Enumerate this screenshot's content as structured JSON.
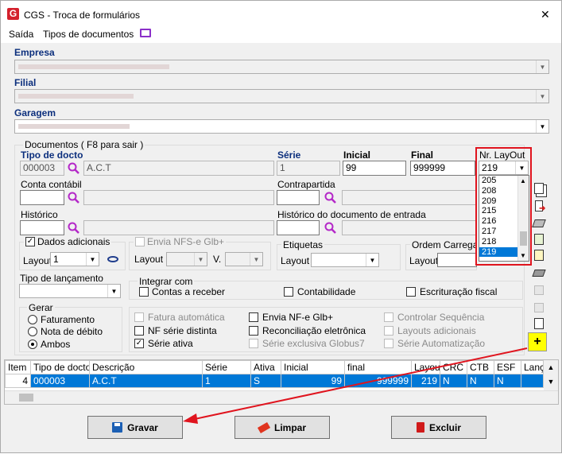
{
  "window": {
    "title": "CGS - Troca de formulários",
    "close_glyph": "✕"
  },
  "menu": {
    "exit": "Saída",
    "doc_types": "Tipos de documentos"
  },
  "empresa": {
    "label": "Empresa"
  },
  "filial": {
    "label": "Filial"
  },
  "garagem": {
    "label": "Garagem"
  },
  "docs_group": "Documentos ( F8 para sair )",
  "tipo_docto": {
    "label": "Tipo de docto",
    "code": "000003",
    "desc": "A.C.T"
  },
  "serie": {
    "label": "Série",
    "value": "1"
  },
  "inicial": {
    "label": "Inicial",
    "value": "99"
  },
  "final": {
    "label": "Final",
    "value": "999999"
  },
  "layout_nr": {
    "label": "Nr. LayOut",
    "value": "219",
    "options": [
      "205",
      "208",
      "209",
      "215",
      "216",
      "217",
      "218",
      "219"
    ],
    "selected": "219"
  },
  "conta": {
    "label": "Conta contábil"
  },
  "contrapartida": {
    "label": "Contrapartida"
  },
  "historico": {
    "label": "Histórico"
  },
  "hist_entrada": {
    "label": "Histórico do documento de entrada"
  },
  "dados": {
    "label": "Dados adicionais",
    "checked": true,
    "layout_label": "Layout",
    "layout_value": "1"
  },
  "nfse": {
    "label": "Envia NFS-e Glb+",
    "layout_label": "Layout",
    "v_label": "V."
  },
  "etiquetas": {
    "label": "Etiquetas",
    "layout_label": "Layout"
  },
  "ordem": {
    "label": "Ordem Carregame",
    "layout_label": "Layout"
  },
  "tipo_lanc": {
    "label": "Tipo de lançamento"
  },
  "integrar": {
    "label": "Integrar com",
    "contas": "Contas a receber",
    "contab": "Contabilidade",
    "escrit": "Escrituração fiscal"
  },
  "gerar": {
    "label": "Gerar",
    "fat": "Faturamento",
    "nd": "Nota de débito",
    "ambos": "Ambos",
    "selected": "Ambos"
  },
  "opts": {
    "fat_auto": "Fatura automática",
    "nf_serie": "NF série distinta",
    "serie_ativa": "Série ativa",
    "envia_nfe": "Envia NF-e Glb+",
    "recon": "Reconciliação eletrônica",
    "serie_excl": "Série exclusiva Globus7",
    "ctrl_seq": "Controlar Sequência",
    "layouts_ad": "Layouts adicionais",
    "serie_auto": "Série Automatização",
    "plus": "+"
  },
  "grid": {
    "headers": [
      "Item",
      "Tipo de docto",
      "Descrição",
      "Série",
      "Ativa",
      "Inicial",
      "final",
      "Layout",
      "CRC",
      "CTB",
      "ESF",
      "Lanç"
    ],
    "row": [
      "4",
      "000003",
      "A.C.T",
      "1",
      "S",
      "99",
      "999999",
      "219",
      "N",
      "N",
      "N",
      ""
    ]
  },
  "buttons": {
    "save": "Gravar",
    "clear": "Limpar",
    "delete": "Excluir"
  },
  "colors": {
    "accent": "#0078d7",
    "annotation": "#e0141e",
    "highlight": "#ffff00",
    "heading": "#0c2f7d"
  }
}
